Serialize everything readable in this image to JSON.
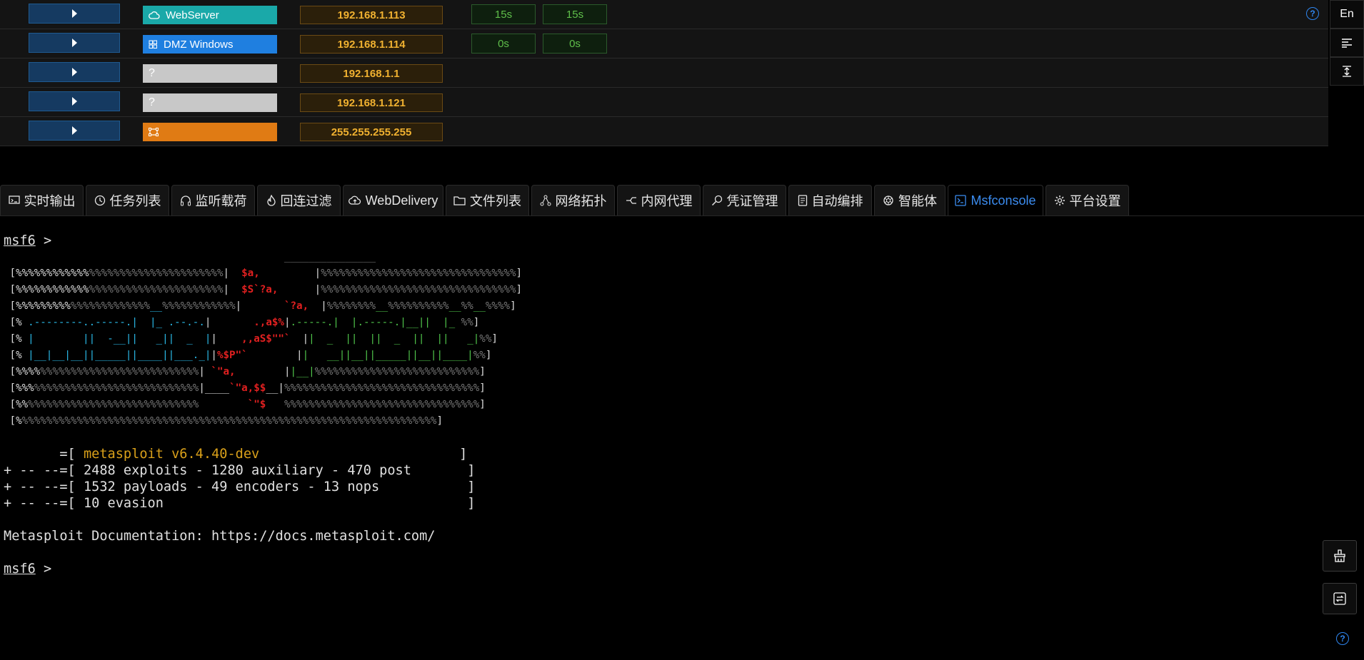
{
  "hosts": [
    {
      "os_label": "WebServer",
      "os_icon": "cloud-icon",
      "os_color": "#1aa9a9",
      "ip": "192.168.1.113",
      "time1": "15s",
      "time2": "15s"
    },
    {
      "os_label": "DMZ Windows",
      "os_icon": "windows-icon",
      "os_color": "#1f7fe0",
      "ip": "192.168.1.114",
      "time1": "0s",
      "time2": "0s"
    },
    {
      "os_label": "",
      "os_icon": "question-icon",
      "os_color": "#c8c8c8",
      "ip": "192.168.1.1"
    },
    {
      "os_label": "",
      "os_icon": "question-icon",
      "os_color": "#c8c8c8",
      "ip": "192.168.1.121"
    },
    {
      "os_label": "",
      "os_icon": "router-icon",
      "os_color": "#e07b14",
      "ip": "255.255.255.255"
    }
  ],
  "right_toolbar": {
    "lang": "En"
  },
  "tabs": [
    {
      "label": "实时输出",
      "icon": "monitor-icon"
    },
    {
      "label": "任务列表",
      "icon": "clock-icon"
    },
    {
      "label": "监听载荷",
      "icon": "headphones-icon"
    },
    {
      "label": "回连过滤",
      "icon": "flame-icon"
    },
    {
      "label": "WebDelivery",
      "icon": "cloud-upload-icon"
    },
    {
      "label": "文件列表",
      "icon": "folder-icon"
    },
    {
      "label": "网络拓扑",
      "icon": "topology-icon"
    },
    {
      "label": "内网代理",
      "icon": "proxy-icon"
    },
    {
      "label": "凭证管理",
      "icon": "search-key-icon"
    },
    {
      "label": "自动编排",
      "icon": "book-icon"
    },
    {
      "label": "智能体",
      "icon": "openai-icon"
    },
    {
      "label": "Msfconsole",
      "icon": "terminal-icon",
      "active": true
    },
    {
      "label": "平台设置",
      "icon": "gear-icon"
    }
  ],
  "terminal": {
    "prompt": "msf6",
    "prompt_suffix": " >",
    "version_prefix": "       =[ ",
    "version": "metasploit v6.4.40-dev",
    "version_suffix": "                         ]",
    "stats": [
      "+ -- --=[ 2488 exploits - 1280 auxiliary - 470 post       ]",
      "+ -- --=[ 1532 payloads - 49 encoders - 13 nops           ]",
      "+ -- --=[ 10 evasion                                      ]"
    ],
    "docs": "Metasploit Documentation: https://docs.metasploit.com/"
  }
}
